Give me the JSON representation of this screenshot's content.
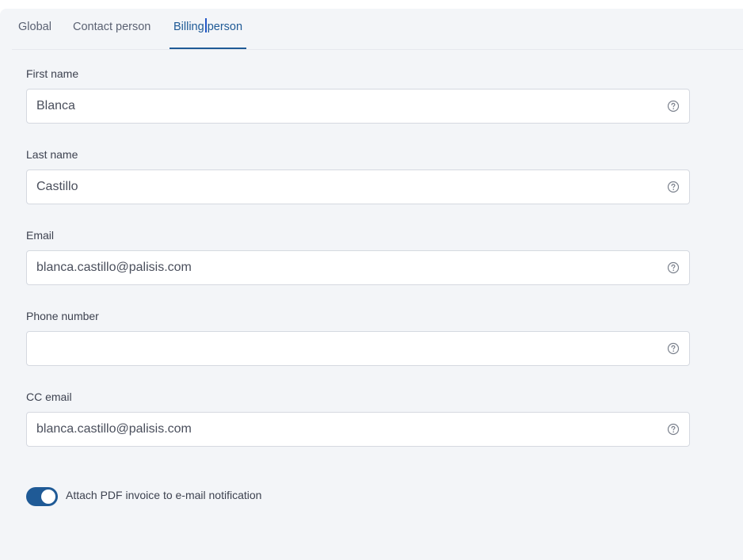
{
  "tabs": [
    {
      "label": "Global"
    },
    {
      "label": "Contact person"
    },
    {
      "label_part1": "Billing",
      "label_part2": "person"
    }
  ],
  "fields": {
    "first_name": {
      "label": "First name",
      "value": "Blanca"
    },
    "last_name": {
      "label": "Last name",
      "value": "Castillo"
    },
    "email": {
      "label": "Email",
      "value": "blanca.castillo@palisis.com"
    },
    "phone": {
      "label": "Phone number",
      "value": ""
    },
    "cc_email": {
      "label": "CC email",
      "value": "blanca.castillo@palisis.com"
    }
  },
  "toggle": {
    "label": "Attach PDF invoice to e-mail notification",
    "checked": true
  },
  "icons": {
    "help": "question-circle-icon"
  },
  "colors": {
    "accent": "#1f5a96",
    "panel_bg": "#f3f5f8"
  }
}
